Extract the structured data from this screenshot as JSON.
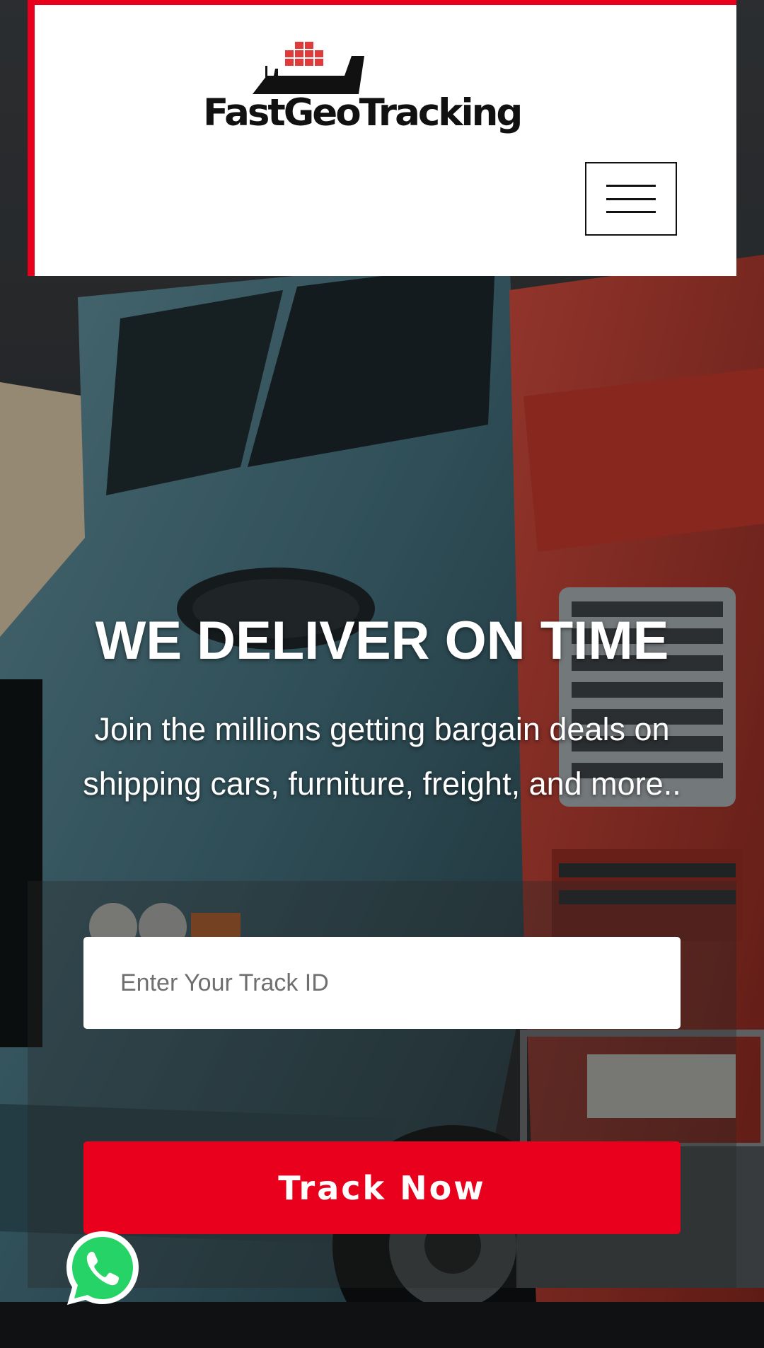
{
  "brand": {
    "name": "FastGeoTracking",
    "accent_color": "#e8001c"
  },
  "header": {
    "menu_icon": "hamburger-menu-icon"
  },
  "hero": {
    "title": "WE DELIVER ON TIME",
    "subtitle": "Join the millions getting bargain deals on shipping cars, furniture, freight, and more.."
  },
  "tracking": {
    "input_placeholder": "Enter Your Track ID",
    "input_value": "",
    "button_label": "Track Now"
  },
  "floating": {
    "whatsapp_icon": "whatsapp-icon",
    "whatsapp_color": "#25d366"
  }
}
